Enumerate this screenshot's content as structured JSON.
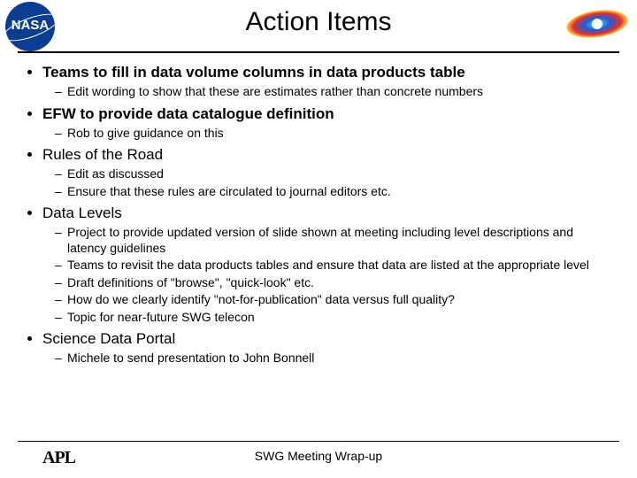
{
  "title": "Action Items",
  "footer": "SWG Meeting Wrap-up",
  "logos": {
    "left": "nasa-meatball",
    "right": "radiation-belt-model",
    "footer_left": "APL"
  },
  "items": [
    {
      "text": "Teams to fill in data volume columns in data products table",
      "bold": true,
      "subs": [
        "Edit wording to show that these are estimates rather than concrete numbers"
      ]
    },
    {
      "text": "EFW to provide data catalogue definition",
      "bold": true,
      "subs": [
        "Rob to give guidance on this"
      ]
    },
    {
      "text": "Rules of the Road",
      "bold": false,
      "subs": [
        "Edit as discussed",
        "Ensure that these rules are circulated to journal editors etc."
      ]
    },
    {
      "text": "Data Levels",
      "bold": false,
      "subs": [
        "Project to provide updated version of slide shown at meeting including level descriptions and latency guidelines",
        "Teams to revisit the data products tables and ensure that data are listed at the appropriate level",
        "Draft definitions of \"browse\", \"quick-look\" etc.",
        "How do we clearly identify \"not-for-publication\" data versus full quality?",
        "Topic for near-future SWG telecon"
      ]
    },
    {
      "text": "Science Data Portal",
      "bold": false,
      "subs": [
        "Michele to send presentation to John Bonnell"
      ]
    }
  ]
}
